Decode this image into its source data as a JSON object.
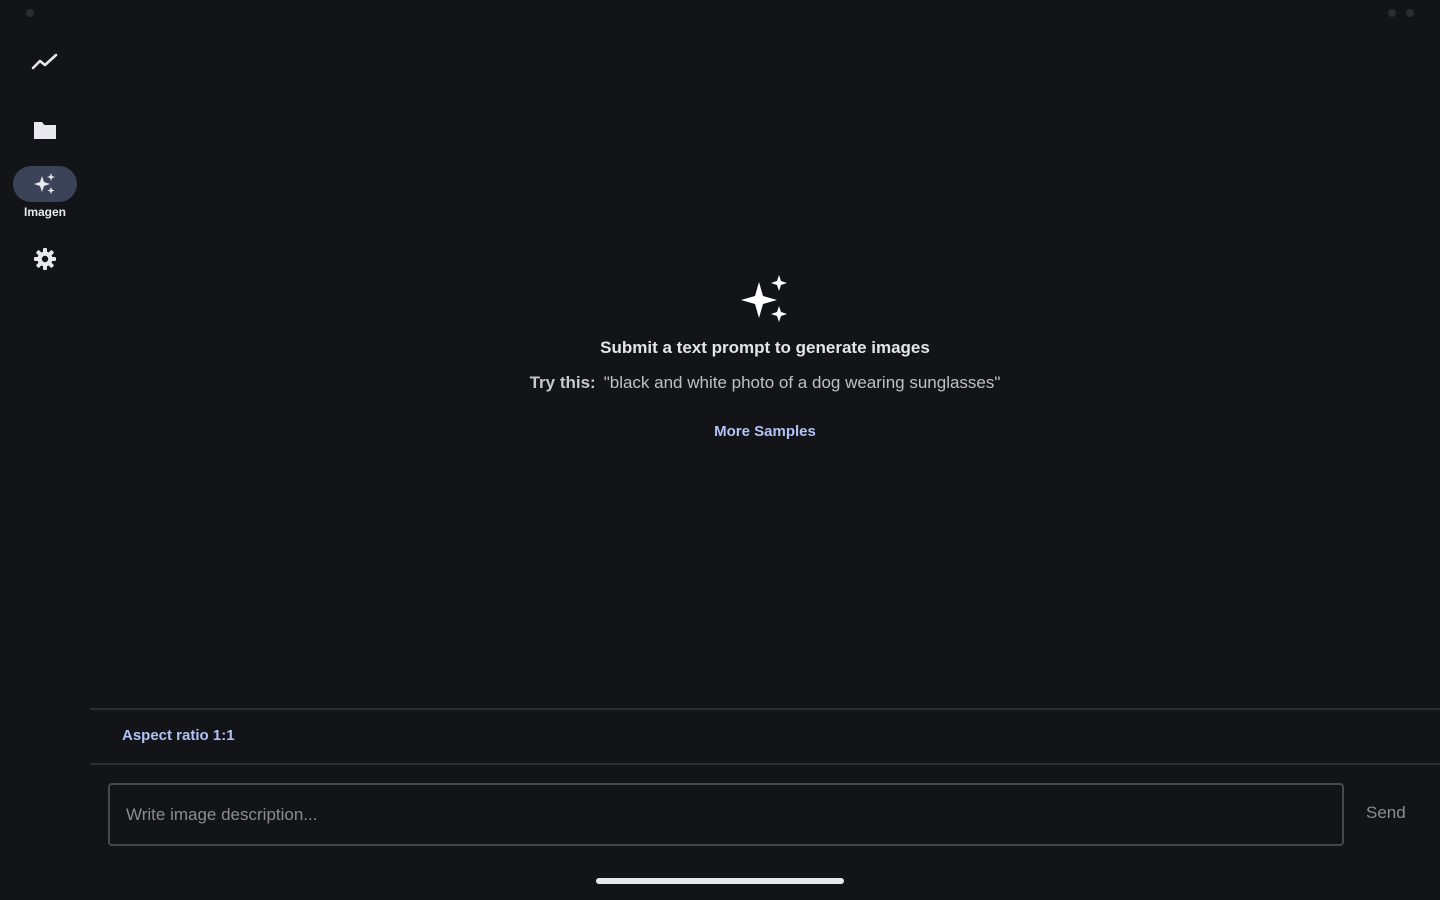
{
  "colors": {
    "background": "#131418",
    "accent": "#b3c2f5",
    "active_nav_bg": "#3c4257"
  },
  "nav": {
    "items": [
      {
        "icon": "trending-icon",
        "label": ""
      },
      {
        "icon": "folder-icon",
        "label": ""
      },
      {
        "icon": "sparkle-icon",
        "label": "Imagen",
        "active": true
      },
      {
        "icon": "gear-icon",
        "label": ""
      }
    ]
  },
  "empty_state": {
    "icon": "sparkle-icon",
    "title": "Submit a text prompt to generate images",
    "try_label": "Try this:",
    "try_example": "\"black and white photo of a dog wearing sunglasses\"",
    "more_samples": "More Samples"
  },
  "composer": {
    "aspect_ratio": "Aspect ratio 1:1",
    "input_value": "",
    "input_placeholder": "Write image description...",
    "send_label": "Send"
  }
}
